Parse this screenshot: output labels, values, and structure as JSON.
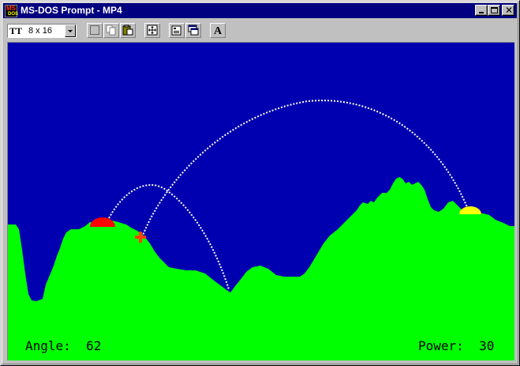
{
  "window": {
    "title": "MS-DOS Prompt - MP4",
    "app_icon_top": "MS",
    "app_icon_bottom": "DOS",
    "close_glyph": "✕"
  },
  "toolbar": {
    "font_icon": "TT",
    "font_size": "8 x 16",
    "buttons": [
      "mark-icon",
      "copy-icon",
      "paste-icon",
      "full-screen-icon",
      "properties-icon",
      "background-icon",
      "font-icon"
    ],
    "font_button_glyph": "A"
  },
  "game": {
    "angle_label": "Angle:",
    "angle_value": "62",
    "power_label": "Power:",
    "power_value": "30",
    "colors": {
      "sky": "#0000b0",
      "ground": "#00ff00",
      "player_tank": "#ff0000",
      "enemy_tank": "#ffff00",
      "explosion": "#ff4000",
      "trail": "#ffffff"
    }
  }
}
